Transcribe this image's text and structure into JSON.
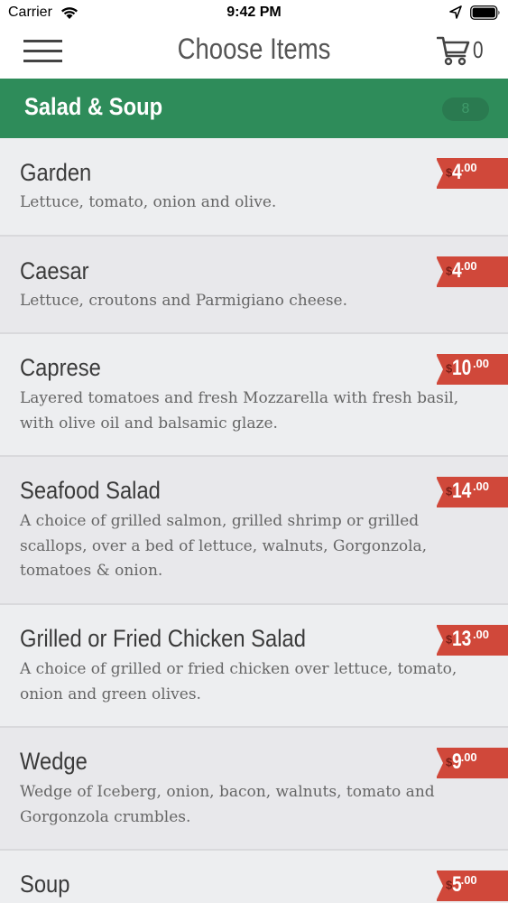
{
  "status_bar": {
    "carrier": "Carrier",
    "time": "9:42 PM",
    "icons": [
      "wifi-icon",
      "location-icon",
      "battery-icon"
    ]
  },
  "nav": {
    "title": "Choose Items",
    "cart_count": "0",
    "icons": [
      "menu-icon",
      "cart-icon"
    ]
  },
  "category": {
    "title": "Salad & Soup",
    "count": "8",
    "color": "#2e8c5a"
  },
  "price_color": "#d0483a",
  "currency_symbol": "$",
  "items": [
    {
      "name": "Garden",
      "description": "Lettuce, tomato, onion and olive.",
      "price_whole": "4",
      "price_cents": ".00"
    },
    {
      "name": "Caesar",
      "description": "Lettuce, croutons and Parmigiano cheese.",
      "price_whole": "4",
      "price_cents": ".00"
    },
    {
      "name": "Caprese",
      "description": "Layered tomatoes and fresh Mozzarella with fresh basil, with olive oil and balsamic glaze.",
      "price_whole": "10",
      "price_cents": ".00"
    },
    {
      "name": "Seafood Salad",
      "description": "A choice of grilled salmon, grilled shrimp or grilled scallops, over a bed of lettuce, walnuts, Gorgonzola, tomatoes & onion.",
      "price_whole": "14",
      "price_cents": ".00"
    },
    {
      "name": "Grilled or Fried Chicken Salad",
      "description": "A choice of grilled or fried chicken over lettuce, tomato, onion and green olives.",
      "price_whole": "13",
      "price_cents": ".00"
    },
    {
      "name": "Wedge",
      "description": "Wedge of Iceberg, onion, bacon, walnuts, tomato and Gorgonzola crumbles.",
      "price_whole": "9",
      "price_cents": ".00"
    },
    {
      "name": "Soup",
      "description": "",
      "price_whole": "5",
      "price_cents": ".00"
    }
  ]
}
